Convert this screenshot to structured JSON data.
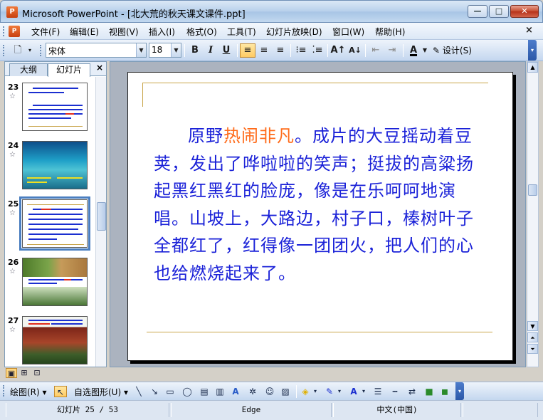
{
  "window": {
    "title": "Microsoft PowerPoint - [北大荒的秋天课文课件.ppt]",
    "app_icon_letter": "P",
    "min_glyph": "—",
    "max_glyph": "□",
    "close_glyph": "✕"
  },
  "menu": {
    "items": [
      "文件(F)",
      "编辑(E)",
      "视图(V)",
      "插入(I)",
      "格式(O)",
      "工具(T)",
      "幻灯片放映(D)",
      "窗口(W)",
      "帮助(H)"
    ],
    "close_glyph": "×"
  },
  "toolbar": {
    "font_name": "宋体",
    "font_size": "18",
    "bold": "B",
    "italic": "I",
    "underline": "U",
    "design_label": "设计(S)"
  },
  "panel": {
    "tab_outline": "大纲",
    "tab_slides": "幻灯片",
    "close_glyph": "×",
    "slides": [
      {
        "num": "23"
      },
      {
        "num": "24"
      },
      {
        "num": "25"
      },
      {
        "num": "26"
      },
      {
        "num": "27"
      }
    ]
  },
  "slide": {
    "text_before": "原野",
    "text_highlight": "热闹非凡",
    "text_after": "。成片的大豆摇动着豆荚，发出了哗啦啦的笑声；挺拔的高粱扬起黑红黑红的脸庞，像是在乐呵呵地演唱。山坡上，大路边，村子口，榛树叶子全都红了，红得像一团团火，把人们的心也给燃烧起来了。",
    "text_color": "#1b22d8",
    "highlight_color": "#ff6b1a"
  },
  "drawbar": {
    "draw_label": "绘图(R)",
    "autoshape_label": "自选图形(U)"
  },
  "status": {
    "slide_info": "幻灯片 25 / 53",
    "template": "Edge",
    "language": "中文(中国)"
  }
}
